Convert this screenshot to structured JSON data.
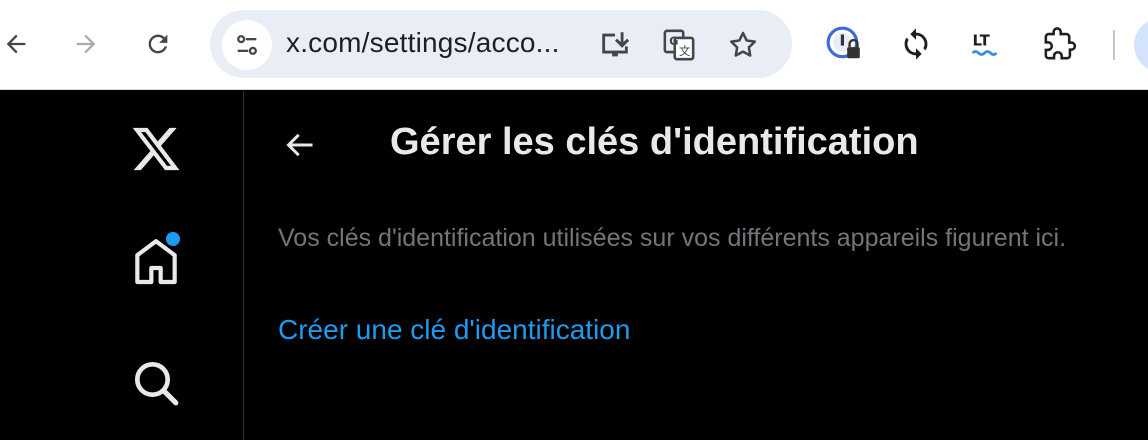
{
  "browser": {
    "url": "x.com/settings/acco..."
  },
  "page": {
    "title": "Gérer les clés d'identification",
    "description": "Vos clés d'identification utilisées sur vos différents appareils figurent ici.",
    "create_link": "Créer une clé d'identification"
  },
  "extensions": {
    "languagetool_label": "LT"
  },
  "colors": {
    "accent": "#1d9bf0",
    "background": "#000000",
    "title": "#e7e9ea",
    "secondary_text": "#71767b"
  }
}
